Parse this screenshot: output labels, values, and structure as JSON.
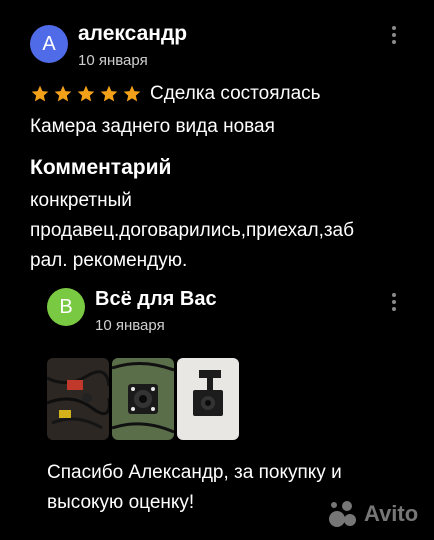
{
  "review": {
    "author_initial": "A",
    "author_name": "александр",
    "date": "10 января",
    "rating_count": 5,
    "deal_status": "Сделка состоялась",
    "item_title": "Камера заднего вида новая",
    "comment_heading": "Комментарий",
    "comment_line1": "конкретный",
    "comment_line2": "продавец.договарились,приехал,заб",
    "comment_line3": "рал. рекомендую.",
    "colors": {
      "avatar": "#4f6be8",
      "star": "#f4a11a"
    }
  },
  "reply": {
    "author_initial": "В",
    "author_name": "Всё для Вас",
    "date": "10 января",
    "photos": [
      "camera-wiring-photo",
      "camera-front-photo",
      "camera-bracket-photo"
    ],
    "text_line1": "Спасибо Александр, за покупку и",
    "text_line2": "высокую оценку!",
    "colors": {
      "avatar": "#7ac943"
    }
  },
  "watermark": {
    "brand": "Avito",
    "icon": "avito-logo-icon"
  }
}
